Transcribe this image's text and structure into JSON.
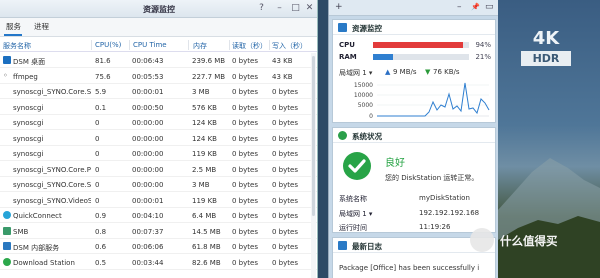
{
  "window": {
    "title": "资源监控",
    "controls": [
      "?",
      "–",
      "□",
      "✕"
    ],
    "tabs": [
      "服务",
      "进程"
    ],
    "columns": {
      "name": "服务名称",
      "cpu": "CPU(%)",
      "time": "CPU Time",
      "mem": "内存",
      "read": "读取（秒）",
      "write": "写入（秒）"
    },
    "rows": [
      {
        "icon": "dsm",
        "name": "DSM 桌面",
        "cpu": "81.6",
        "time": "00:06:43",
        "mem": "239.6 MB",
        "read": "0 bytes",
        "write": "43 KB"
      },
      {
        "icon": "ffm",
        "name": "ffmpeg",
        "cpu": "75.6",
        "time": "00:05:53",
        "mem": "227.7 MB",
        "read": "0 bytes",
        "write": "43 KB"
      },
      {
        "icon": "none",
        "name": "synoscgi_SYNO.Core.Sy",
        "cpu": "5.9",
        "time": "00:00:01",
        "mem": "3 MB",
        "read": "0 bytes",
        "write": "0 bytes"
      },
      {
        "icon": "none",
        "name": "synoscgi",
        "cpu": "0.1",
        "time": "00:00:50",
        "mem": "576 KB",
        "read": "0 bytes",
        "write": "0 bytes"
      },
      {
        "icon": "none",
        "name": "synoscgi",
        "cpu": "0",
        "time": "00:00:00",
        "mem": "124 KB",
        "read": "0 bytes",
        "write": "0 bytes"
      },
      {
        "icon": "none",
        "name": "synoscgi",
        "cpu": "0",
        "time": "00:00:00",
        "mem": "124 KB",
        "read": "0 bytes",
        "write": "0 bytes"
      },
      {
        "icon": "none",
        "name": "synoscgi",
        "cpu": "0",
        "time": "00:00:00",
        "mem": "119 KB",
        "read": "0 bytes",
        "write": "0 bytes"
      },
      {
        "icon": "none",
        "name": "synoscgi_SYNO.Core.Pa",
        "cpu": "0",
        "time": "00:00:00",
        "mem": "2.5 MB",
        "read": "0 bytes",
        "write": "0 bytes"
      },
      {
        "icon": "none",
        "name": "synoscgi_SYNO.Core.Sy",
        "cpu": "0",
        "time": "00:00:00",
        "mem": "3 MB",
        "read": "0 bytes",
        "write": "0 bytes"
      },
      {
        "icon": "none",
        "name": "synoscgi_SYNO.VideoSt",
        "cpu": "0",
        "time": "00:00:01",
        "mem": "119 KB",
        "read": "0 bytes",
        "write": "0 bytes"
      },
      {
        "icon": "qc",
        "name": "QuickConnect",
        "cpu": "0.9",
        "time": "00:04:10",
        "mem": "6.4 MB",
        "read": "0 bytes",
        "write": "0 bytes"
      },
      {
        "icon": "smb",
        "name": "SMB",
        "cpu": "0.8",
        "time": "00:07:37",
        "mem": "14.5 MB",
        "read": "0 bytes",
        "write": "0 bytes"
      },
      {
        "icon": "svc",
        "name": "DSM 内部服务",
        "cpu": "0.6",
        "time": "00:06:06",
        "mem": "61.8 MB",
        "read": "0 bytes",
        "write": "0 bytes"
      },
      {
        "icon": "dl",
        "name": "Download Station",
        "cpu": "0.5",
        "time": "00:03:44",
        "mem": "82.6 MB",
        "read": "0 bytes",
        "write": "0 bytes"
      }
    ]
  },
  "panel": {
    "head_controls": [
      "+",
      "–",
      "📌",
      "▭"
    ],
    "resource": {
      "title": "资源监控",
      "cpu_label": "CPU",
      "cpu_value": "94%",
      "cpu_fraction": 0.94,
      "ram_label": "RAM",
      "ram_value": "21%",
      "ram_fraction": 0.21,
      "cpu_color": "#e23b3b",
      "ram_color": "#2f7fd0",
      "net_label": "局域网 1 ▾",
      "up_value": "9 MB/s",
      "down_value": "76 KB/s",
      "chart_ticks": [
        "15000",
        "10000",
        "5000",
        "0"
      ]
    },
    "status": {
      "title": "系统状况",
      "state": "良好",
      "message": "您的 DiskStation 运转正常。",
      "server_label": "系统名称",
      "server_value": "myDiskStation",
      "lan_label": "局域网 1 ▾",
      "lan_value": "192.192.192.168",
      "uptime_label": "运行时间",
      "uptime_value": "11:19:26"
    },
    "log": {
      "title": "最新日志",
      "line": "Package [Office] has been successfully i"
    }
  },
  "desktop": {
    "logo_top": "4K",
    "logo_bottom": "HDR",
    "watermark": "什么值得买"
  }
}
